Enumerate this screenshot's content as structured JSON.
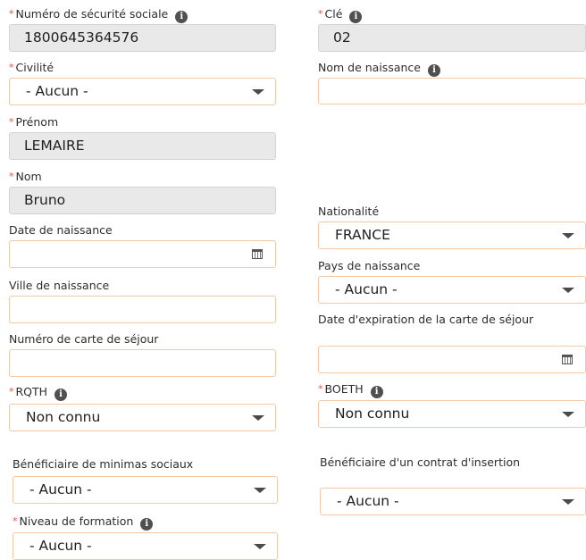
{
  "fields": {
    "nss": {
      "label": "Numéro de sécurité sociale",
      "value": "1800645364576"
    },
    "cle": {
      "label": "Clé",
      "value": "02"
    },
    "civilite": {
      "label": "Civilité",
      "value": "- Aucun -"
    },
    "nom_naissance": {
      "label": "Nom de naissance",
      "value": ""
    },
    "prenom": {
      "label": "Prénom",
      "value": "LEMAIRE"
    },
    "nom": {
      "label": "Nom",
      "value": "Bruno"
    },
    "nationalite": {
      "label": "Nationalité",
      "value": "FRANCE"
    },
    "date_naissance": {
      "label": "Date de naissance",
      "value": ""
    },
    "pays_naissance": {
      "label": "Pays de naissance",
      "value": "- Aucun -"
    },
    "ville_naissance": {
      "label": "Ville de naissance",
      "value": ""
    },
    "date_expiration": {
      "label": "Date d'expiration de la carte de séjour",
      "value": ""
    },
    "num_carte_sejour": {
      "label": "Numéro de carte de séjour",
      "value": ""
    },
    "rqth": {
      "label": "RQTH",
      "value": "Non connu"
    },
    "boeth": {
      "label": "BOETH",
      "value": "Non connu"
    },
    "minimas": {
      "label": "Bénéficiaire de minimas sociaux",
      "value": "- Aucun -"
    },
    "contrat_insertion": {
      "label": "Bénéficiaire d'un contrat d'insertion",
      "value": "- Aucun -"
    },
    "niveau_formation": {
      "label": "Niveau de formation",
      "value": "- Aucun -"
    }
  },
  "required_marker": "*",
  "info_glyph": "i",
  "icons": {
    "info": "info-icon",
    "dropdown": "chevron-down-icon",
    "calendar": "calendar-icon"
  },
  "colors": {
    "required": "#e0564f",
    "input_border": "#f1c9a8",
    "readonly_bg": "#e9e9e9"
  }
}
